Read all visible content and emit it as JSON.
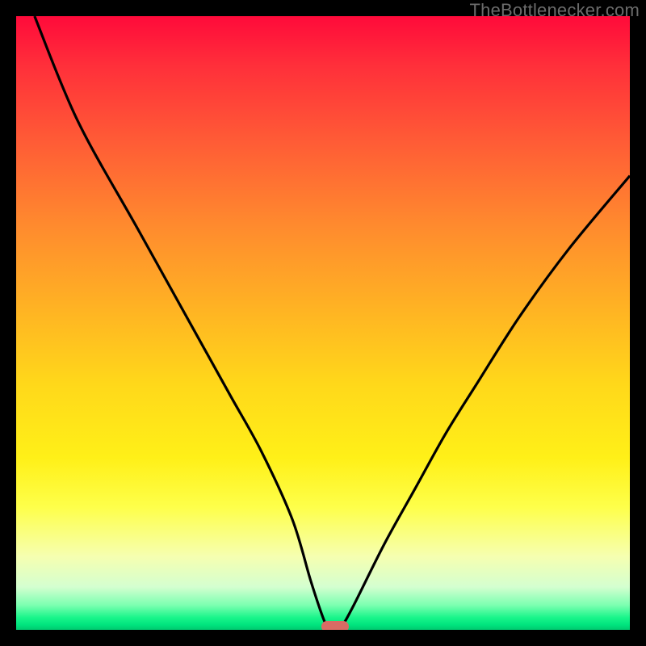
{
  "attribution": "TheBottlenecker.com",
  "chart_data": {
    "type": "line",
    "title": "",
    "xlabel": "",
    "ylabel": "",
    "xlim": [
      0,
      100
    ],
    "ylim": [
      0,
      100
    ],
    "x": [
      3,
      10,
      20,
      30,
      35,
      40,
      45,
      48,
      50,
      51,
      52,
      53,
      55,
      60,
      65,
      70,
      75,
      82,
      90,
      100
    ],
    "values": [
      100,
      83,
      65,
      47,
      38,
      29,
      18,
      8,
      2,
      0,
      0,
      0.5,
      4,
      14,
      23,
      32,
      40,
      51,
      62,
      74
    ],
    "marker": {
      "x": 52,
      "y": 0
    },
    "background_gradient": {
      "stops": [
        {
          "pos": 0.0,
          "color": "#ff0a3a"
        },
        {
          "pos": 0.5,
          "color": "#ffd81a"
        },
        {
          "pos": 0.8,
          "color": "#feff4a"
        },
        {
          "pos": 1.0,
          "color": "#00c86e"
        }
      ]
    }
  },
  "colors": {
    "frame": "#000000",
    "curve": "#000000",
    "marker": "#d96b64",
    "attribution_text": "#6b6b6b"
  }
}
